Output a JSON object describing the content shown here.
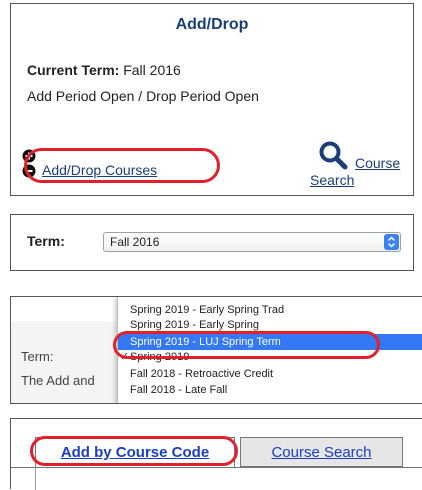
{
  "adddrop": {
    "title": "Add/Drop",
    "current_term_label": "Current Term:",
    "current_term_value": "Fall 2016",
    "period_status": "Add Period Open / Drop Period Open",
    "add_drop_courses": "Add/Drop Courses",
    "course_search_line1": "Course",
    "course_search_line2": "Search"
  },
  "term_select": {
    "label": "Term:",
    "selected_value": "Fall 2016"
  },
  "dropdown": {
    "behind_term_label": "Term:",
    "behind_text": "The Add and",
    "items": [
      {
        "label": "Spring 2019 - Early Spring Trad",
        "selected": false,
        "checked": false
      },
      {
        "label": "Spring 2019 - Early Spring",
        "selected": false,
        "checked": false
      },
      {
        "label": "Spring 2019 - LUJ Spring Term",
        "selected": true,
        "checked": false
      },
      {
        "label": "Spring 2019",
        "selected": false,
        "checked": true
      },
      {
        "label": "Fall 2018 - Retroactive Credit",
        "selected": false,
        "checked": false
      },
      {
        "label": "Fall 2018 - Late Fall",
        "selected": false,
        "checked": false
      }
    ]
  },
  "tabs": {
    "add_by_code": "Add by Course Code",
    "course_search": "Course Search"
  },
  "colors": {
    "link": "#1a3e78",
    "tab_link": "#1a3ec8",
    "highlight": "#e0202a",
    "selection": "#3478f6"
  },
  "icons": {
    "add_remove": "plus-minus-icon",
    "search": "magnifier-icon",
    "select_arrows": "chevron-updown-icon",
    "check": "checkmark-icon"
  }
}
